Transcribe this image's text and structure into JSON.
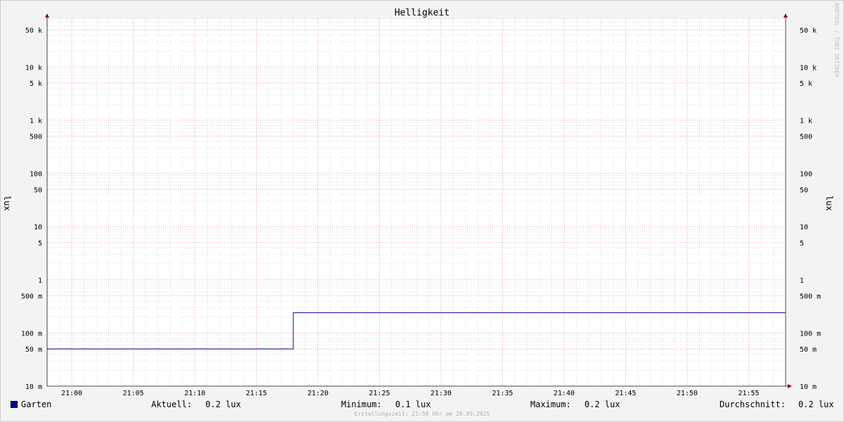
{
  "chart_data": {
    "type": "line",
    "title": "Helligkeit",
    "ylabel": "lux",
    "yscale": "log",
    "ylim": [
      0.01,
      80000
    ],
    "x_ticks": [
      "21:00",
      "21:05",
      "21:10",
      "21:15",
      "21:20",
      "21:25",
      "21:30",
      "21:35",
      "21:40",
      "21:45",
      "21:50",
      "21:55"
    ],
    "x_tick_minutes": [
      0,
      5,
      10,
      15,
      20,
      25,
      30,
      35,
      40,
      45,
      50,
      55
    ],
    "xlim_minutes": [
      -2,
      58
    ],
    "y_ticks": [
      {
        "value": 50000,
        "label": "50 k"
      },
      {
        "value": 10000,
        "label": "10 k"
      },
      {
        "value": 5000,
        "label": "5 k"
      },
      {
        "value": 1000,
        "label": "1 k"
      },
      {
        "value": 500,
        "label": "500"
      },
      {
        "value": 100,
        "label": "100"
      },
      {
        "value": 50,
        "label": "50"
      },
      {
        "value": 10,
        "label": "10"
      },
      {
        "value": 5,
        "label": "5"
      },
      {
        "value": 1,
        "label": "1"
      },
      {
        "value": 0.5,
        "label": "500 m"
      },
      {
        "value": 0.1,
        "label": "100 m"
      },
      {
        "value": 0.05,
        "label": "50 m"
      },
      {
        "value": 0.01,
        "label": "10 m"
      }
    ],
    "grid": true,
    "series": [
      {
        "name": "Garten",
        "color": "#00009c",
        "x_minutes": [
          -2,
          18,
          18,
          58
        ],
        "y": [
          0.05,
          0.05,
          0.24,
          0.24
        ]
      }
    ]
  },
  "legend": {
    "series_name": "Garten",
    "swatch_color": "#00009c",
    "aktuell_label": "Aktuell:",
    "aktuell_value": "0.2 lux",
    "minimum_label": "Minimum:",
    "minimum_value": "0.1 lux",
    "maximum_label": "Maximum:",
    "maximum_value": "0.2 lux",
    "durchschnitt_label": "Durchschnitt:",
    "durchschnitt_value": "0.2 lux"
  },
  "footer": "Erstellungszeit: 21:58 Uhr am 20.09.2025",
  "watermark": "RRDTOOL / TOBI OETIKER"
}
